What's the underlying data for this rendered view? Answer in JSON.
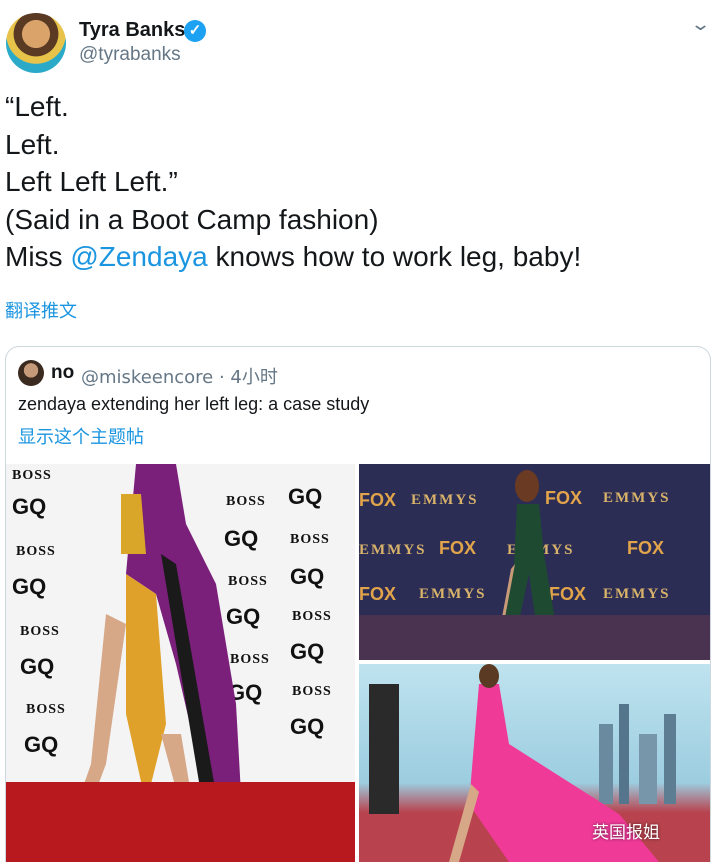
{
  "tweet": {
    "name": "Tyra Banks",
    "handle": "@tyrabanks",
    "lines": [
      "“Left.",
      "Left.",
      "Left Left Left.”",
      "(Said in a Boot Camp fashion)"
    ],
    "last_line_prefix": "Miss ",
    "mention": "@Zendaya",
    "last_line_suffix": " knows how to work leg, baby!",
    "translate": "翻译推文"
  },
  "quote": {
    "name": "no",
    "handle_time": "@miskeencore · 4小时",
    "text": "zendaya extending her left leg: a case study",
    "show_thread": "显示这个主题帖"
  },
  "photos": {
    "gq_logos": [
      "BOSS",
      "GQ"
    ],
    "emmy_logos": [
      "EMMYS",
      "FOX"
    ]
  },
  "watermark": "英国报姐",
  "colors": {
    "accent": "#1da1f2",
    "link": "#1b95e0",
    "secondary": "#657786"
  }
}
